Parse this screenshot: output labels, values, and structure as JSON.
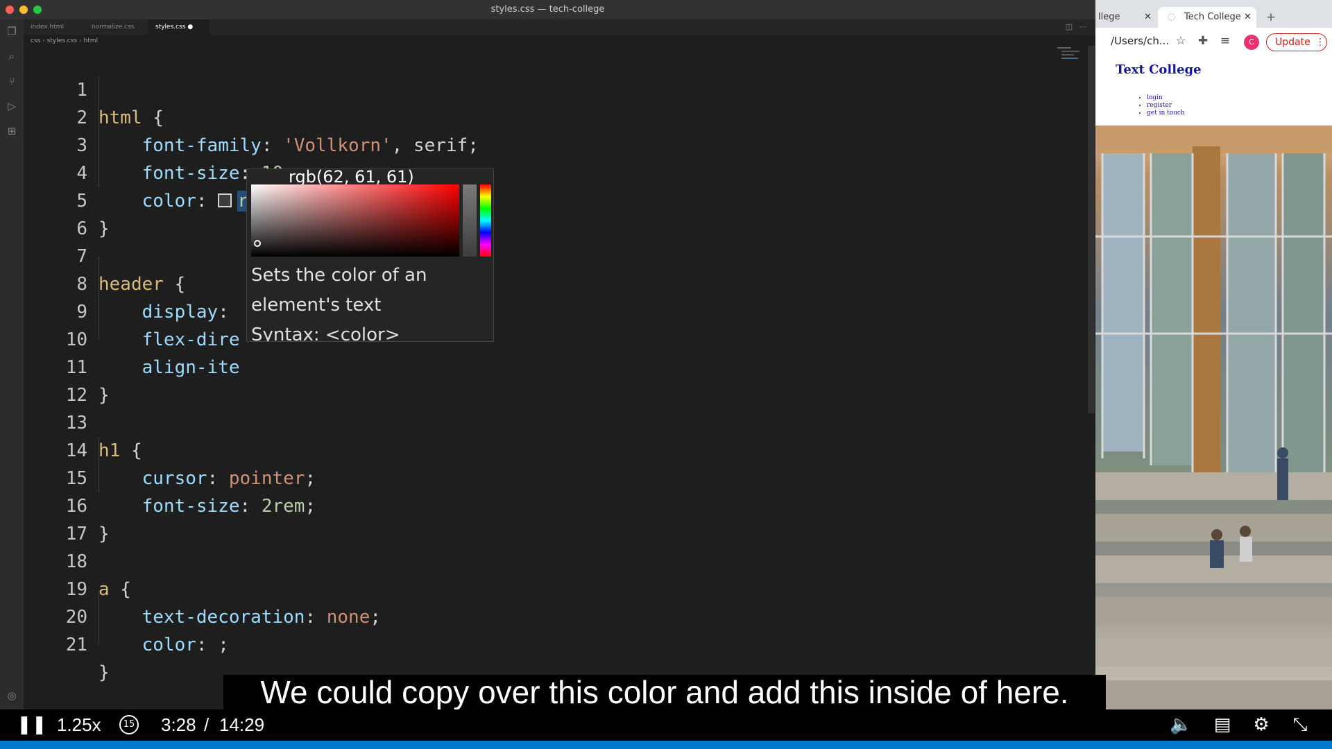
{
  "editor": {
    "title": "styles.css — tech-college",
    "tabs": [
      {
        "label": "index.html"
      },
      {
        "label": "normalize.css"
      },
      {
        "label": "styles.css ●"
      }
    ],
    "breadcrumb": [
      "css",
      "styles.css",
      "html"
    ],
    "lines": [
      {
        "n": "1"
      },
      {
        "n": "2"
      },
      {
        "n": "3"
      },
      {
        "n": "4"
      },
      {
        "n": "5"
      },
      {
        "n": "6"
      },
      {
        "n": "7"
      },
      {
        "n": "8"
      },
      {
        "n": "9"
      },
      {
        "n": "10"
      },
      {
        "n": "11"
      },
      {
        "n": "12"
      },
      {
        "n": "13"
      },
      {
        "n": "14"
      },
      {
        "n": "15"
      },
      {
        "n": "16"
      },
      {
        "n": "17"
      },
      {
        "n": "18"
      },
      {
        "n": "19"
      },
      {
        "n": "20"
      },
      {
        "n": "21"
      }
    ],
    "code": {
      "l1_sel": "html",
      "l1_brace": " {",
      "l2_prop": "font-family",
      "l2_val": "'Vollkorn'",
      "l2_rest": ", serif;",
      "l3_prop": "font-size",
      "l3_val": "10px",
      "l3_rest": ";",
      "l4_prop": "color",
      "l4_val": "rgb(62,61,61)",
      "l4_rest": ";",
      "l5": "}",
      "l7_sel": "header",
      "l7_brace": " {",
      "l8_prop": "display",
      "l9_prop": "flex-dire",
      "l10_prop": "align-ite",
      "l11": "}",
      "l13_sel": "h1",
      "l13_brace": " {",
      "l14_prop": "cursor",
      "l14_val": "pointer",
      "l14_rest": ";",
      "l15_prop": "font-size",
      "l15_val": "2rem",
      "l15_rest": ";",
      "l16": "}",
      "l18_sel": "a",
      "l18_brace": " {",
      "l19_prop": "text-decoration",
      "l19_val": "none",
      "l19_rest": ";",
      "l20_prop": "color",
      "l20_rest": ";",
      "l21": "}"
    },
    "picker": {
      "value": "rgb(62, 61, 61)",
      "desc_1": "Sets the color of an",
      "desc_2": "element's text",
      "desc_3": "Syntax: <color>"
    }
  },
  "browser": {
    "tab_1": "llege",
    "tab_2": "Tech College",
    "address": "/Users/ch...",
    "profile_initial": "C",
    "update_label": "Update",
    "page_title": "Text College",
    "nav": [
      "login",
      "register",
      "get in touch"
    ]
  },
  "video": {
    "caption": "We could copy over this color and add this inside of here.",
    "speed": "1.25x",
    "skip_back": "15",
    "current_time": "3:28",
    "separator": "/",
    "duration": "14:29"
  },
  "colors": {
    "editor_bg": "#1e1e1e",
    "selector": "#d7ba7d",
    "property": "#9cdcfe",
    "string": "#ce9178",
    "number": "#b5cea8",
    "link": "#1515a3",
    "update": "#c5221f",
    "statusbar": "#007acc"
  }
}
